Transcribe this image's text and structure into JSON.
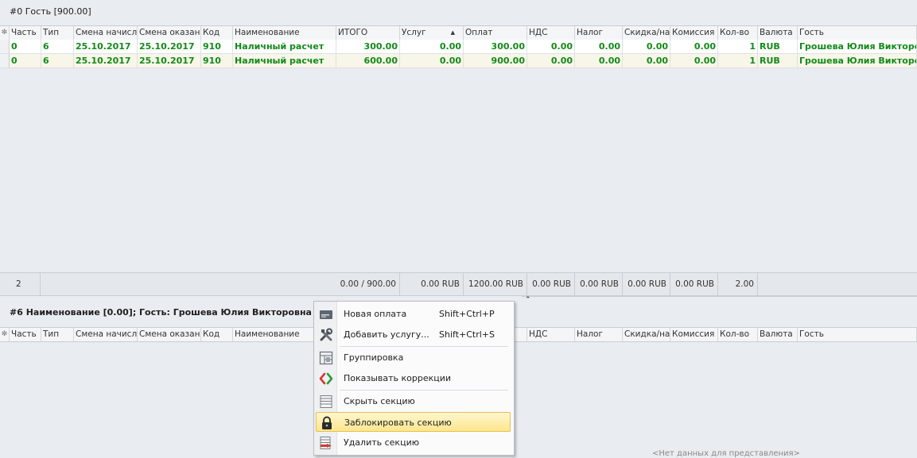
{
  "section1": {
    "title": "#0 Гость [900.00]",
    "columns": [
      "Часть",
      "Тип",
      "Смена начисле",
      "Смена оказани",
      "Код",
      "Наименование",
      "ИТОГО",
      "Услуг",
      "Оплат",
      "НДС",
      "Налог",
      "Скидка/наце",
      "Комиссия",
      "Кол-во",
      "Валюта",
      "Гость"
    ],
    "rows": [
      [
        "0",
        "6",
        "25.10.2017",
        "25.10.2017",
        "910",
        "Наличный расчет",
        "300.00",
        "0.00",
        "300.00",
        "0.00",
        "0.00",
        "0.00",
        "0.00",
        "1",
        "RUB",
        "Грошева Юлия Викторовна"
      ],
      [
        "0",
        "6",
        "25.10.2017",
        "25.10.2017",
        "910",
        "Наличный расчет",
        "600.00",
        "0.00",
        "900.00",
        "0.00",
        "0.00",
        "0.00",
        "0.00",
        "1",
        "RUB",
        "Грошева Юлия Викторовна"
      ]
    ],
    "footer": {
      "count": "2",
      "itogo": "0.00 / 900.00",
      "uslug": "0.00 RUB",
      "oplat": "1200.00 RUB",
      "nds": "0.00 RUB",
      "nalog": "0.00 RUB",
      "skidka": "0.00 RUB",
      "komissiya": "0.00 RUB",
      "kolvo": "2.00"
    }
  },
  "section2": {
    "title": "#6 Наименование [0.00]; Гость: Грошева Юлия Викторовна",
    "columns": [
      "Часть",
      "Тип",
      "Смена начисле",
      "Смена оказани",
      "Код",
      "Наименование",
      "",
      "",
      "",
      "НДС",
      "Налог",
      "Скидка/наце",
      "Комиссия",
      "Кол-во",
      "Валюта",
      "Гость"
    ],
    "empty_message": "<Нет данных для представления>"
  },
  "context_menu": {
    "items": [
      {
        "label": "Новая оплата",
        "shortcut": "Shift+Ctrl+P",
        "icon": "new-payment-icon"
      },
      {
        "label": "Добавить услугу...",
        "shortcut": "Shift+Ctrl+S",
        "icon": "tools-icon"
      },
      {
        "label": "Группировка",
        "shortcut": "",
        "icon": "grouping-icon"
      },
      {
        "label": "Показывать коррекции",
        "shortcut": "",
        "icon": "corrections-icon"
      },
      {
        "label": "Скрыть секцию",
        "shortcut": "",
        "icon": "hide-section-icon"
      },
      {
        "label": "Заблокировать секцию",
        "shortcut": "",
        "icon": "lock-icon"
      },
      {
        "label": "Удалить секцию",
        "shortcut": "",
        "icon": "delete-section-icon"
      }
    ],
    "highlighted_index": 5
  },
  "colors": {
    "green_text": "#138a1a",
    "highlight": "#fde68e",
    "row_alt": "#f7f6e8"
  }
}
